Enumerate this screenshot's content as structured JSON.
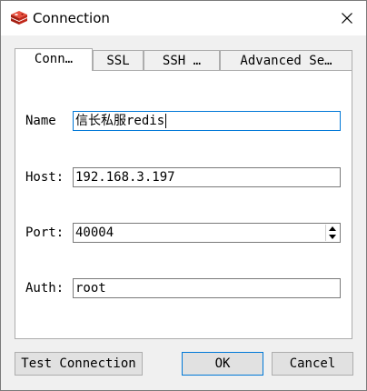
{
  "window": {
    "title": "Connection"
  },
  "tabs": [
    {
      "label": "Conn…",
      "active": true
    },
    {
      "label": "SSL",
      "active": false
    },
    {
      "label": "SSH …",
      "active": false
    },
    {
      "label": "Advanced Se…",
      "active": false
    }
  ],
  "form": {
    "name": {
      "label": "Name",
      "value": "信长私服redis"
    },
    "host": {
      "label": "Host:",
      "value": "192.168.3.197"
    },
    "port": {
      "label": "Port:",
      "value": "40004"
    },
    "auth": {
      "label": "Auth:",
      "value": "root"
    }
  },
  "buttons": {
    "test": "Test Connection",
    "ok": "OK",
    "cancel": "Cancel"
  },
  "colors": {
    "accent": "#0078d7",
    "redis_red": "#d82c20"
  }
}
